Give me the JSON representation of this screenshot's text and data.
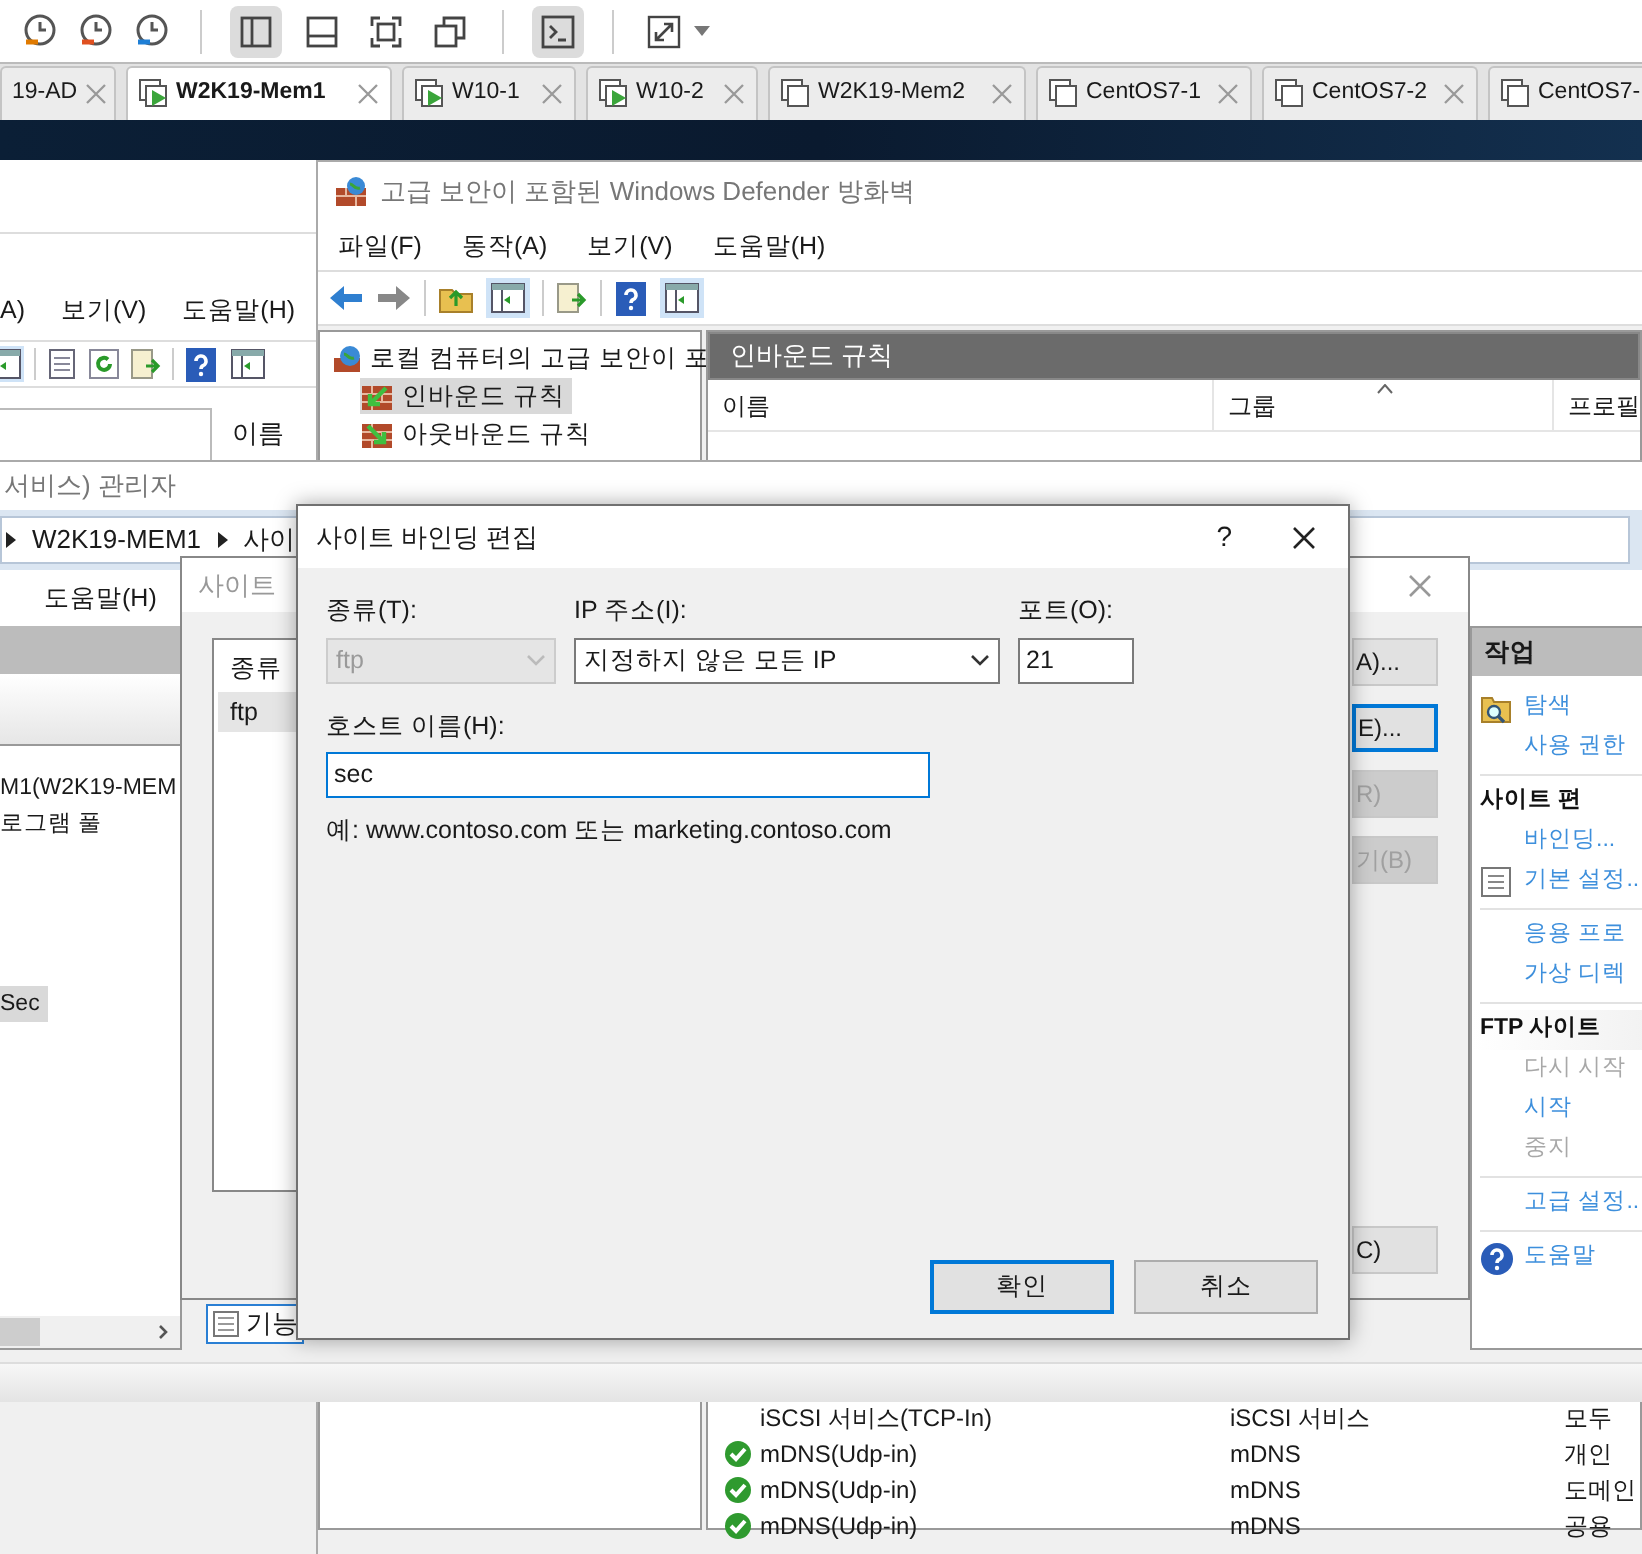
{
  "vm_tabs": [
    {
      "label": "19-AD",
      "selected": false,
      "running": false
    },
    {
      "label": "W2K19-Mem1",
      "selected": true,
      "running": true
    },
    {
      "label": "W10-1",
      "selected": false,
      "running": true
    },
    {
      "label": "W10-2",
      "selected": false,
      "running": true
    },
    {
      "label": "W2K19-Mem2",
      "selected": false,
      "running": false
    },
    {
      "label": "CentOS7-1",
      "selected": false,
      "running": false
    },
    {
      "label": "CentOS7-2",
      "selected": false,
      "running": false
    },
    {
      "label": "CentOS7-",
      "selected": false,
      "running": false
    }
  ],
  "mmc_window": {
    "menu": [
      "A)",
      "보기(V)",
      "도움말(H)"
    ],
    "column": "이름"
  },
  "firewall_window": {
    "title": "고급 보안이 포함된 Windows Defender 방화벽",
    "menu": [
      "파일(F)",
      "동작(A)",
      "보기(V)",
      "도움말(H)"
    ],
    "tree": [
      {
        "label": "로컬 컴퓨터의 고급 보안이 포",
        "selected": false,
        "children": [
          {
            "label": "인바운드 규칙",
            "selected": true
          },
          {
            "label": "아웃바운드 규칙",
            "selected": false
          }
        ]
      }
    ],
    "panel_title": "인바운드 규칙",
    "columns": [
      "이름",
      "그룹",
      "프로필"
    ],
    "rows": [
      {
        "name": "iSCSI 서비스(TCP-In)",
        "group": "iSCSI 서비스",
        "profile": "모두",
        "enabled": false
      },
      {
        "name": "mDNS(Udp-in)",
        "group": "mDNS",
        "profile": "개인",
        "enabled": true
      },
      {
        "name": "mDNS(Udp-in)",
        "group": "mDNS",
        "profile": "도메인",
        "enabled": true
      },
      {
        "name": "mDNS(Udp-in)",
        "group": "mDNS",
        "profile": "공용",
        "enabled": true
      }
    ]
  },
  "iis_window": {
    "title": "서비스) 관리자",
    "breadcrumb": [
      "W2K19-MEM1",
      "사이"
    ],
    "menu": [
      "도움말(H)"
    ],
    "tree": [
      {
        "label": "M1(W2K19-MEM",
        "selected": false
      },
      {
        "label": "로그램 풀",
        "selected": false
      },
      {
        "label": "Sec",
        "selected": true
      }
    ],
    "bottom_tab": "기능",
    "actions": {
      "title": "작업",
      "items": [
        {
          "kind": "link",
          "label": "탐색",
          "icon": true
        },
        {
          "kind": "link",
          "label": "사용 권한",
          "icon": false
        },
        {
          "kind": "separator"
        },
        {
          "kind": "heading",
          "label": "사이트 편",
          "icon": false
        },
        {
          "kind": "link",
          "label": "바인딩...",
          "icon": false
        },
        {
          "kind": "link",
          "label": "기본 설정..",
          "icon": true
        },
        {
          "kind": "separator"
        },
        {
          "kind": "link",
          "label": "응용 프로",
          "icon": false
        },
        {
          "kind": "link",
          "label": "가상 디렉",
          "icon": false
        },
        {
          "kind": "separator"
        },
        {
          "kind": "heading",
          "label": "FTP 사이트",
          "icon": false
        },
        {
          "kind": "disabled",
          "label": "다시 시작",
          "icon": false
        },
        {
          "kind": "link",
          "label": "시작",
          "icon": false
        },
        {
          "kind": "disabled",
          "label": "중지",
          "icon": false
        },
        {
          "kind": "separator"
        },
        {
          "kind": "link",
          "label": "고급 설정..",
          "icon": false
        },
        {
          "kind": "separator"
        },
        {
          "kind": "link",
          "label": "도움말",
          "icon": true
        }
      ]
    }
  },
  "bindings_dialog": {
    "title": "사이트",
    "list_header": "종류",
    "list_rows": [
      {
        "label": "ftp",
        "selected": true
      }
    ],
    "buttons": [
      {
        "label": "A)...",
        "disabled": false,
        "focused": false
      },
      {
        "label": "E)...",
        "disabled": false,
        "focused": true
      },
      {
        "label": "R)",
        "disabled": true,
        "focused": false
      },
      {
        "label": "기(B)",
        "disabled": true,
        "focused": false
      },
      {
        "label": "C)",
        "disabled": false,
        "focused": false
      }
    ]
  },
  "edit_dialog": {
    "title": "사이트 바인딩 편집",
    "help": "?",
    "type_label": "종류(T):",
    "type_value": "ftp",
    "type_disabled": true,
    "ip_label": "IP 주소(I):",
    "ip_value": "지정하지 않은 모든 IP",
    "port_label": "포트(O):",
    "port_value": "21",
    "host_label": "호스트 이름(H):",
    "host_value": "sec",
    "example": "예: www.contoso.com 또는 marketing.contoso.com",
    "buttons": [
      {
        "label": "확인",
        "default": true
      },
      {
        "label": "취소",
        "default": false
      }
    ]
  }
}
